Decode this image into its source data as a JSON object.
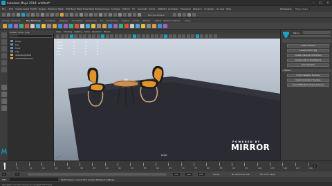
{
  "window": {
    "title": "Autodesk Maya 2018: untitled*"
  },
  "menus": [
    "File",
    "Edit",
    "Create",
    "Select",
    "Modify",
    "Display",
    "Windows",
    "Mesh",
    "Edit Mesh",
    "Mesh Tools",
    "Mesh Display",
    "Curves",
    "Surfaces",
    "Deform",
    "UV",
    "Generate",
    "Cache",
    "ARNOLD",
    "Animation",
    "Character",
    "Skeleton",
    "Constrain",
    "Go Live",
    "Help"
  ],
  "status": {
    "workspace_label": "Workspace:",
    "workspace": "Maya Classic",
    "symmetry": "No Live Surface"
  },
  "shelf_tabs": [
    "Curves / Surfaces",
    "Poly Modeling",
    "Sculpting",
    "Rigging",
    "Animation",
    "Rendering",
    "FX",
    "FX Caching",
    "Custom",
    "Arnold",
    "Bifrost",
    "MASH",
    "Motion Graphics",
    "XGen"
  ],
  "outliner": {
    "menu": [
      "Display",
      "Show",
      "Help"
    ],
    "search_placeholder": "Search...",
    "items": [
      "persp",
      "top",
      "front",
      "side",
      "defaultLightSet",
      "defaultObjectSet"
    ]
  },
  "viewport": {
    "menu": [
      "View",
      "Shading",
      "Lighting",
      "Show",
      "Renderer",
      "Panels"
    ],
    "camera": "persp",
    "hud": {
      "rows": [
        {
          "label": "Verts:",
          "v1": "0",
          "v2": "0",
          "v3": "0"
        },
        {
          "label": "Edges:",
          "v1": "0",
          "v2": "0",
          "v3": "0"
        },
        {
          "label": "Faces:",
          "v1": "0",
          "v2": "0",
          "v3": "0"
        },
        {
          "label": "Tris:",
          "v1": "0",
          "v2": "0",
          "v3": "0"
        },
        {
          "label": "UVs:",
          "v1": "0",
          "v2": "0",
          "v3": "0"
        }
      ]
    },
    "logo_top": "POWERED BY",
    "logo": "MIRROR"
  },
  "rightpanel": {
    "header": "Mirror",
    "buttons_a": [
      "Create Skeleton",
      "Create Custom Rig",
      "Create Character Definitions",
      "Create Custom Rig Mapping",
      "Quick Rig Tool"
    ],
    "section_b": "Utilities",
    "buttons_b": [
      "Import Skeleton Example",
      "Import Animation Example",
      "Import FBX Mirror Example Scene"
    ]
  },
  "timeline": {
    "ticks": [
      "1",
      "5",
      "10",
      "15",
      "20",
      "25",
      "30",
      "35",
      "40",
      "45",
      "50",
      "55",
      "60",
      "65",
      "70",
      "75",
      "80",
      "85",
      "90",
      "95",
      "100",
      "105",
      "110",
      "115",
      "120"
    ],
    "current_frame": "1"
  },
  "range": {
    "start": "1",
    "start2": "1",
    "end": "120",
    "end2": "120",
    "end3": "200",
    "fps": "24 fps",
    "char_set": "No Character Set",
    "anim_layer": "No Anim Layer"
  },
  "cmdline": {
    "label": "MEL",
    "message": "Performance: cannot find Cached Playback settings."
  },
  "help": {
    "text": "Navigate: Use Alt+mouse to navigate the scene"
  },
  "colors": {
    "accent": "#19a1c9",
    "chair_orange": "#e0922b",
    "chair_black": "#1c1c1c",
    "floor": "#2a2b33",
    "table_wood": "#c89050"
  }
}
